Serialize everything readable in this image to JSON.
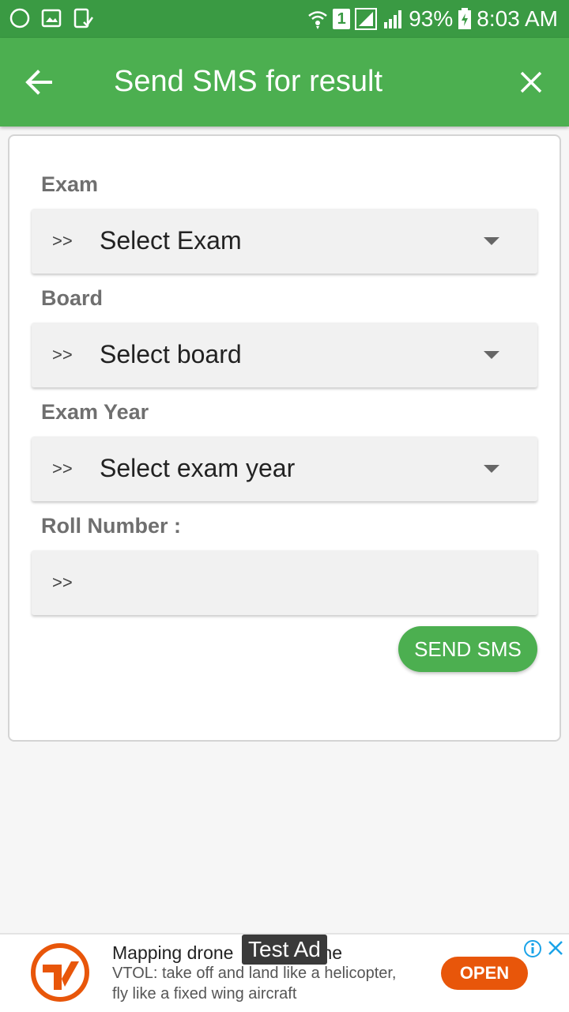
{
  "status_bar": {
    "battery": "93%",
    "time": "8:03 AM",
    "sim": "1",
    "icons": [
      "moon-icon",
      "gallery-icon",
      "device-icon",
      "wifi-icon",
      "signal-icon",
      "battery-icon"
    ]
  },
  "app_bar": {
    "title": "Send SMS for result",
    "back_icon": "back-arrow-icon",
    "close_icon": "close-icon"
  },
  "form": {
    "exam": {
      "label": "Exam",
      "prefix": ">>",
      "value": "Select Exam"
    },
    "board": {
      "label": "Board",
      "prefix": ">>",
      "value": "Select board"
    },
    "year": {
      "label": "Exam Year",
      "prefix": ">>",
      "value": "Select exam year"
    },
    "roll": {
      "label": "Roll Number :",
      "prefix": ">>",
      "value": ""
    },
    "send_label": "SEND SMS"
  },
  "ad": {
    "overlay": "Test Ad",
    "title": "Mapping drone",
    "title_suffix": "ne",
    "desc": "VTOL: take off and land like a helicopter, fly like a fixed wing aircraft",
    "cta": "OPEN"
  },
  "colors": {
    "status_bar": "#3a9a43",
    "app_bar": "#4caf50",
    "button": "#4caf50",
    "ad_cta": "#e8560a"
  }
}
